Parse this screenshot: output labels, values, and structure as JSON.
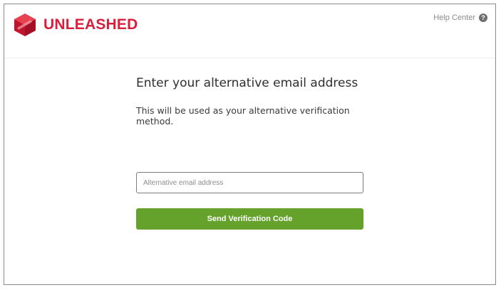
{
  "header": {
    "brand_name": "UNLEASHED",
    "help_label": "Help Center",
    "help_icon": "question-circle-icon",
    "logo_icon": "unleashed-cube-logo"
  },
  "main": {
    "title": "Enter your alternative email address",
    "subtitle": "This will be used as your alternative verification method.",
    "email_input": {
      "placeholder": "Alternative email address",
      "value": ""
    },
    "send_button_label": "Send Verification Code"
  },
  "colors": {
    "brand_red": "#d81e3a",
    "button_green": "#64a22c",
    "frame_border": "#8a8a8a",
    "help_text": "#8b8b8b"
  }
}
